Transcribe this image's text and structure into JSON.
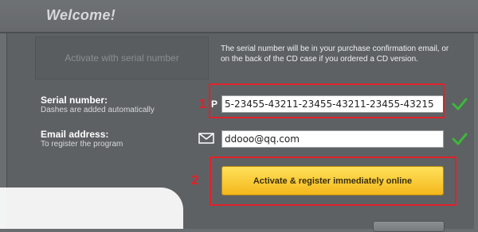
{
  "window": {
    "title": "Welcome!"
  },
  "activation": {
    "tab_label": "Activate with serial number",
    "description": "The serial number will be in your purchase confirmation email, or on the back of the CD case if you ordered a CD version."
  },
  "serial": {
    "label": "Serial number:",
    "hint": "Dashes are added automatically",
    "prefix": "P",
    "value": "5-23455-43211-23455-43211-23455-43215",
    "step": "1"
  },
  "email": {
    "label": "Email address:",
    "hint": "To register the program",
    "value": "ddooo@qq.com"
  },
  "action": {
    "step": "2",
    "button_label": "Activate & register immediately online"
  },
  "colors": {
    "annotation_red": "#e0222a",
    "valid_green": "#3cb83a",
    "button_yellow": "#f7c62a"
  },
  "icons": [
    "mail-icon",
    "checkmark-icon"
  ]
}
